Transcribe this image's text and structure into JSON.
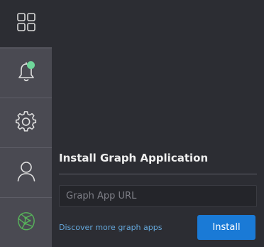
{
  "sidebar": {
    "items": [
      {
        "icon": "grid-icon",
        "has_badge": false
      },
      {
        "icon": "bell-icon",
        "has_badge": true,
        "badge_color": "#6fd69a"
      },
      {
        "icon": "gear-icon",
        "has_badge": false
      },
      {
        "icon": "user-icon",
        "has_badge": false
      },
      {
        "icon": "graph-app-icon",
        "has_badge": false
      }
    ]
  },
  "install_panel": {
    "title": "Install Graph Application",
    "url_placeholder": "Graph App URL",
    "url_value": "",
    "discover_link": "Discover more graph apps",
    "install_label": "Install"
  },
  "colors": {
    "background": "#2c2d33",
    "sidebar": "#4a4a52",
    "accent_blue": "#1a7ad6",
    "link": "#65a8dc",
    "badge_green": "#6fd69a",
    "graph_icon_green": "#57b35a"
  }
}
